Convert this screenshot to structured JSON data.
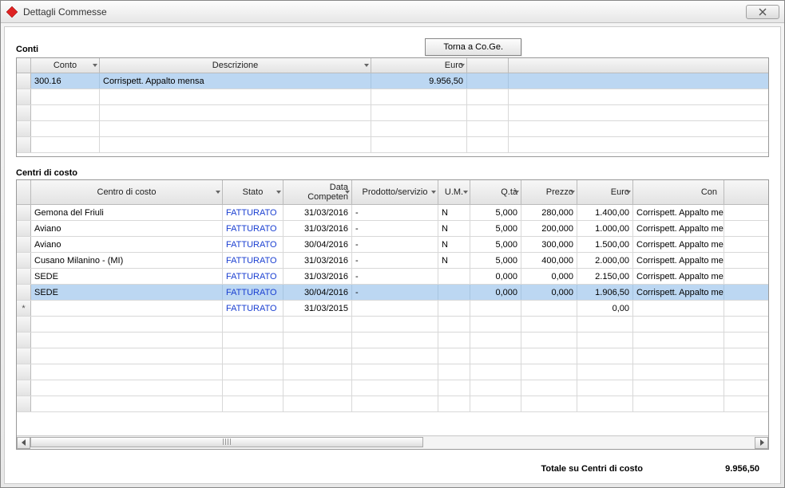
{
  "window": {
    "title": "Dettagli Commesse"
  },
  "buttons": {
    "torna": "Torna a Co.Ge."
  },
  "sections": {
    "conti": "Conti",
    "centri": "Centri di costo"
  },
  "grid1": {
    "headers": {
      "conto": "Conto",
      "descrizione": "Descrizione",
      "euro": "Euro"
    },
    "rows": [
      {
        "conto": "300.16",
        "descrizione": "Corrispett. Appalto mensa",
        "euro": "9.956,50"
      }
    ]
  },
  "grid2": {
    "headers": {
      "centro": "Centro di costo",
      "stato": "Stato",
      "data": "Data Competen",
      "prodotto": "Prodotto/servizio",
      "um": "U.M.",
      "qta": "Q.tà",
      "prezzo": "Prezzo",
      "euro": "Euro",
      "conto": "Con"
    },
    "rows": [
      {
        "centro": "Gemona del Friuli",
        "stato": "FATTURATO",
        "data": "31/03/2016",
        "prodotto": "-",
        "um": "N",
        "qta": "5,000",
        "prezzo": "280,000",
        "euro": "1.400,00",
        "conto": "Corrispett. Appalto me"
      },
      {
        "centro": "Aviano",
        "stato": "FATTURATO",
        "data": "31/03/2016",
        "prodotto": "-",
        "um": "N",
        "qta": "5,000",
        "prezzo": "200,000",
        "euro": "1.000,00",
        "conto": "Corrispett. Appalto me"
      },
      {
        "centro": "Aviano",
        "stato": "FATTURATO",
        "data": "30/04/2016",
        "prodotto": "-",
        "um": "N",
        "qta": "5,000",
        "prezzo": "300,000",
        "euro": "1.500,00",
        "conto": "Corrispett. Appalto me"
      },
      {
        "centro": "Cusano Milanino - (MI)",
        "stato": "FATTURATO",
        "data": "31/03/2016",
        "prodotto": "-",
        "um": "N",
        "qta": "5,000",
        "prezzo": "400,000",
        "euro": "2.000,00",
        "conto": "Corrispett. Appalto me"
      },
      {
        "centro": "SEDE",
        "stato": "FATTURATO",
        "data": "31/03/2016",
        "prodotto": "-",
        "um": "",
        "qta": "0,000",
        "prezzo": "0,000",
        "euro": "2.150,00",
        "conto": "Corrispett. Appalto me"
      },
      {
        "centro": "SEDE",
        "stato": "FATTURATO",
        "data": "30/04/2016",
        "prodotto": "-",
        "um": "",
        "qta": "0,000",
        "prezzo": "0,000",
        "euro": "1.906,50",
        "conto": "Corrispett. Appalto me",
        "selected": true
      },
      {
        "centro": "",
        "stato": "FATTURATO",
        "data": "31/03/2015",
        "prodotto": "",
        "um": "",
        "qta": "",
        "prezzo": "",
        "euro": "0,00",
        "conto": "",
        "newrow": true
      }
    ]
  },
  "footer": {
    "label": "Totale su Centri di costo",
    "value": "9.956,50"
  }
}
